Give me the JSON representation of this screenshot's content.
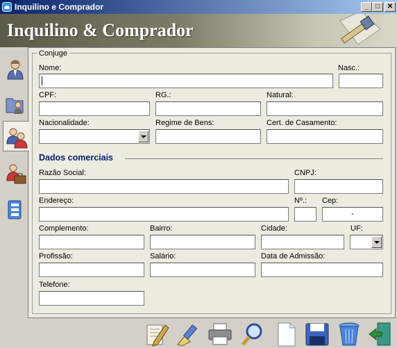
{
  "window": {
    "title": "Inquilino e Comprador",
    "controls": [
      "minimize",
      "maximize",
      "close"
    ]
  },
  "header": {
    "title": "Inquilino & Comprador",
    "logo_icon": "brush-and-paint-icon"
  },
  "sidebar": {
    "items": [
      {
        "name": "person-icon",
        "active": false
      },
      {
        "name": "folder-person-icon",
        "active": false
      },
      {
        "name": "couple-icon",
        "active": true
      },
      {
        "name": "person-briefcase-icon",
        "active": false
      },
      {
        "name": "document-edit-icon",
        "active": false
      }
    ]
  },
  "conjuge": {
    "legend": "Conjuge",
    "nome_label": "Nome:",
    "nome_value": "",
    "nasc_label": "Nasc.:",
    "nasc_value": "",
    "cpf_label": "CPF:",
    "cpf_value": "",
    "rg_label": "RG.:",
    "rg_value": "",
    "natural_label": "Natural:",
    "natural_value": "",
    "nacionalidade_label": "Nacionalidade:",
    "nacionalidade_value": "",
    "regime_label": "Regime de Bens:",
    "regime_value": "",
    "cert_label": "Cert. de Casamento:",
    "cert_value": ""
  },
  "comercial": {
    "title": "Dados comerciais",
    "razao_label": "Razão Social:",
    "razao_value": "",
    "cnpj_label": "CNPJ:",
    "cnpj_value": "",
    "endereco_label": "Endereço:",
    "endereco_value": "",
    "numero_label": "Nº.:",
    "numero_value": "",
    "cep_label": "Cep:",
    "cep_value": "-",
    "complemento_label": "Complemento:",
    "complemento_value": "",
    "bairro_label": "Bairro:",
    "bairro_value": "",
    "cidade_label": "Cidade:",
    "cidade_value": "",
    "uf_label": "UF:",
    "uf_value": "",
    "profissao_label": "Profissão:",
    "profissao_value": "",
    "salario_label": "Salário:",
    "salario_value": "",
    "admissao_label": "Data de Admissão:",
    "admissao_value": "",
    "telefone_label": "Telefone:",
    "telefone_value": ""
  },
  "toolbar": {
    "icons": [
      "edit-pen-icon",
      "clean-brush-icon",
      "printer-icon",
      "search-icon",
      "new-document-icon",
      "save-disk-icon",
      "trash-icon",
      "exit-door-icon"
    ]
  }
}
